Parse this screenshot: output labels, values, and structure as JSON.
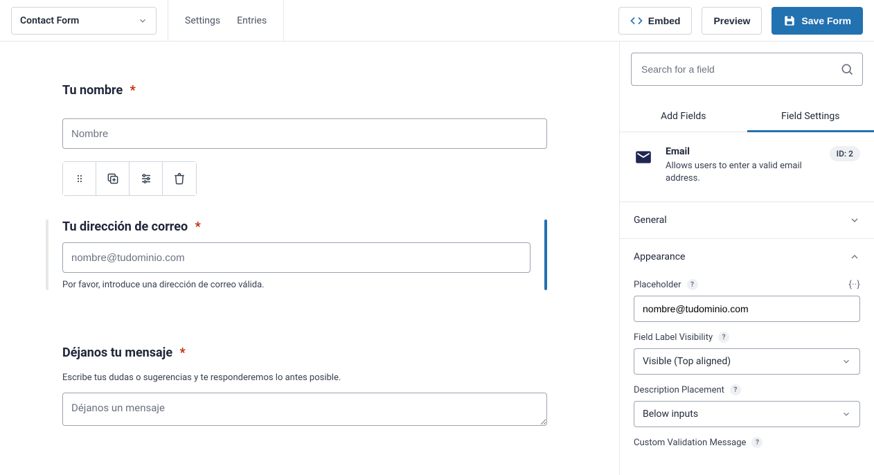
{
  "header": {
    "form_name": "Contact Form",
    "nav": {
      "settings": "Settings",
      "entries": "Entries"
    },
    "embed": "Embed",
    "preview": "Preview",
    "save": "Save Form"
  },
  "canvas": {
    "fields": [
      {
        "key": "name",
        "label": "Tu nombre",
        "required": true,
        "placeholder": "Nombre",
        "show_toolbar": true
      },
      {
        "key": "email",
        "label": "Tu dirección de correo",
        "required": true,
        "placeholder": "nombre@tudominio.com",
        "description": "Por favor, introduce una dirección de correo válida.",
        "selected": true
      },
      {
        "key": "message",
        "label": "Déjanos tu mensaje",
        "required": true,
        "help": "Escribe tus dudas o sugerencias y te responderemos lo antes posible.",
        "placeholder": "Déjanos un mensaje",
        "type": "textarea"
      }
    ]
  },
  "sidebar": {
    "search_placeholder": "Search for a field",
    "tabs": {
      "add": "Add Fields",
      "settings": "Field Settings"
    },
    "field": {
      "type_label": "Email",
      "type_desc": "Allows users to enter a valid email address.",
      "id_label": "ID: 2"
    },
    "sections": {
      "general": "General",
      "appearance": "Appearance",
      "placeholder_label": "Placeholder",
      "placeholder_value": "nombre@tudominio.com",
      "label_visibility_label": "Field Label Visibility",
      "label_visibility_value": "Visible (Top aligned)",
      "desc_placement_label": "Description Placement",
      "desc_placement_value": "Below inputs",
      "custom_validation_label": "Custom Validation Message"
    }
  }
}
